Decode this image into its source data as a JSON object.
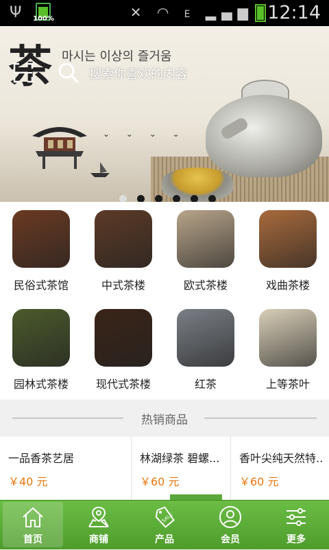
{
  "status_bar": {
    "battery_small_pct": "100%",
    "network_type": "E",
    "time": "12:14"
  },
  "banner": {
    "calligraphy": "茶",
    "korean_text": "마시는 이상의 즐거움",
    "search_placeholder": "搜索你喜欢的内容",
    "slide_count": 6,
    "active_slide": 1
  },
  "categories": [
    {
      "label": "民俗式茶馆",
      "thumb_color": "#6a3a22"
    },
    {
      "label": "中式茶楼",
      "thumb_color": "#5c3a26"
    },
    {
      "label": "欧式茶楼",
      "thumb_color": "#b8a58a"
    },
    {
      "label": "戏曲茶楼",
      "thumb_color": "#a86a3c"
    },
    {
      "label": "园林式茶楼",
      "thumb_color": "#4b5a2c"
    },
    {
      "label": "现代式茶楼",
      "thumb_color": "#3a2418"
    },
    {
      "label": "红茶",
      "thumb_color": "#7a7f86"
    },
    {
      "label": "上等茶叶",
      "thumb_color": "#d9cfb8"
    }
  ],
  "section": {
    "title": "热销商品"
  },
  "products": [
    {
      "name": "一品香茶艺居",
      "price": "￥40 元"
    },
    {
      "name": "林湖绿茶 碧螺...",
      "price": "￥60 元"
    },
    {
      "name": "香叶尖纯天然特...",
      "price": "￥60 元"
    }
  ],
  "tabbar": {
    "items": [
      {
        "label": "首页",
        "icon": "home-icon",
        "active": true
      },
      {
        "label": "商铺",
        "icon": "store-map-icon",
        "active": false
      },
      {
        "label": "产品",
        "icon": "sale-tag-icon",
        "active": false
      },
      {
        "label": "会员",
        "icon": "member-icon",
        "active": false
      },
      {
        "label": "更多",
        "icon": "more-sliders-icon",
        "active": false
      }
    ]
  },
  "colors": {
    "accent_green": "#5aaa36",
    "price_orange": "#e8760c"
  }
}
